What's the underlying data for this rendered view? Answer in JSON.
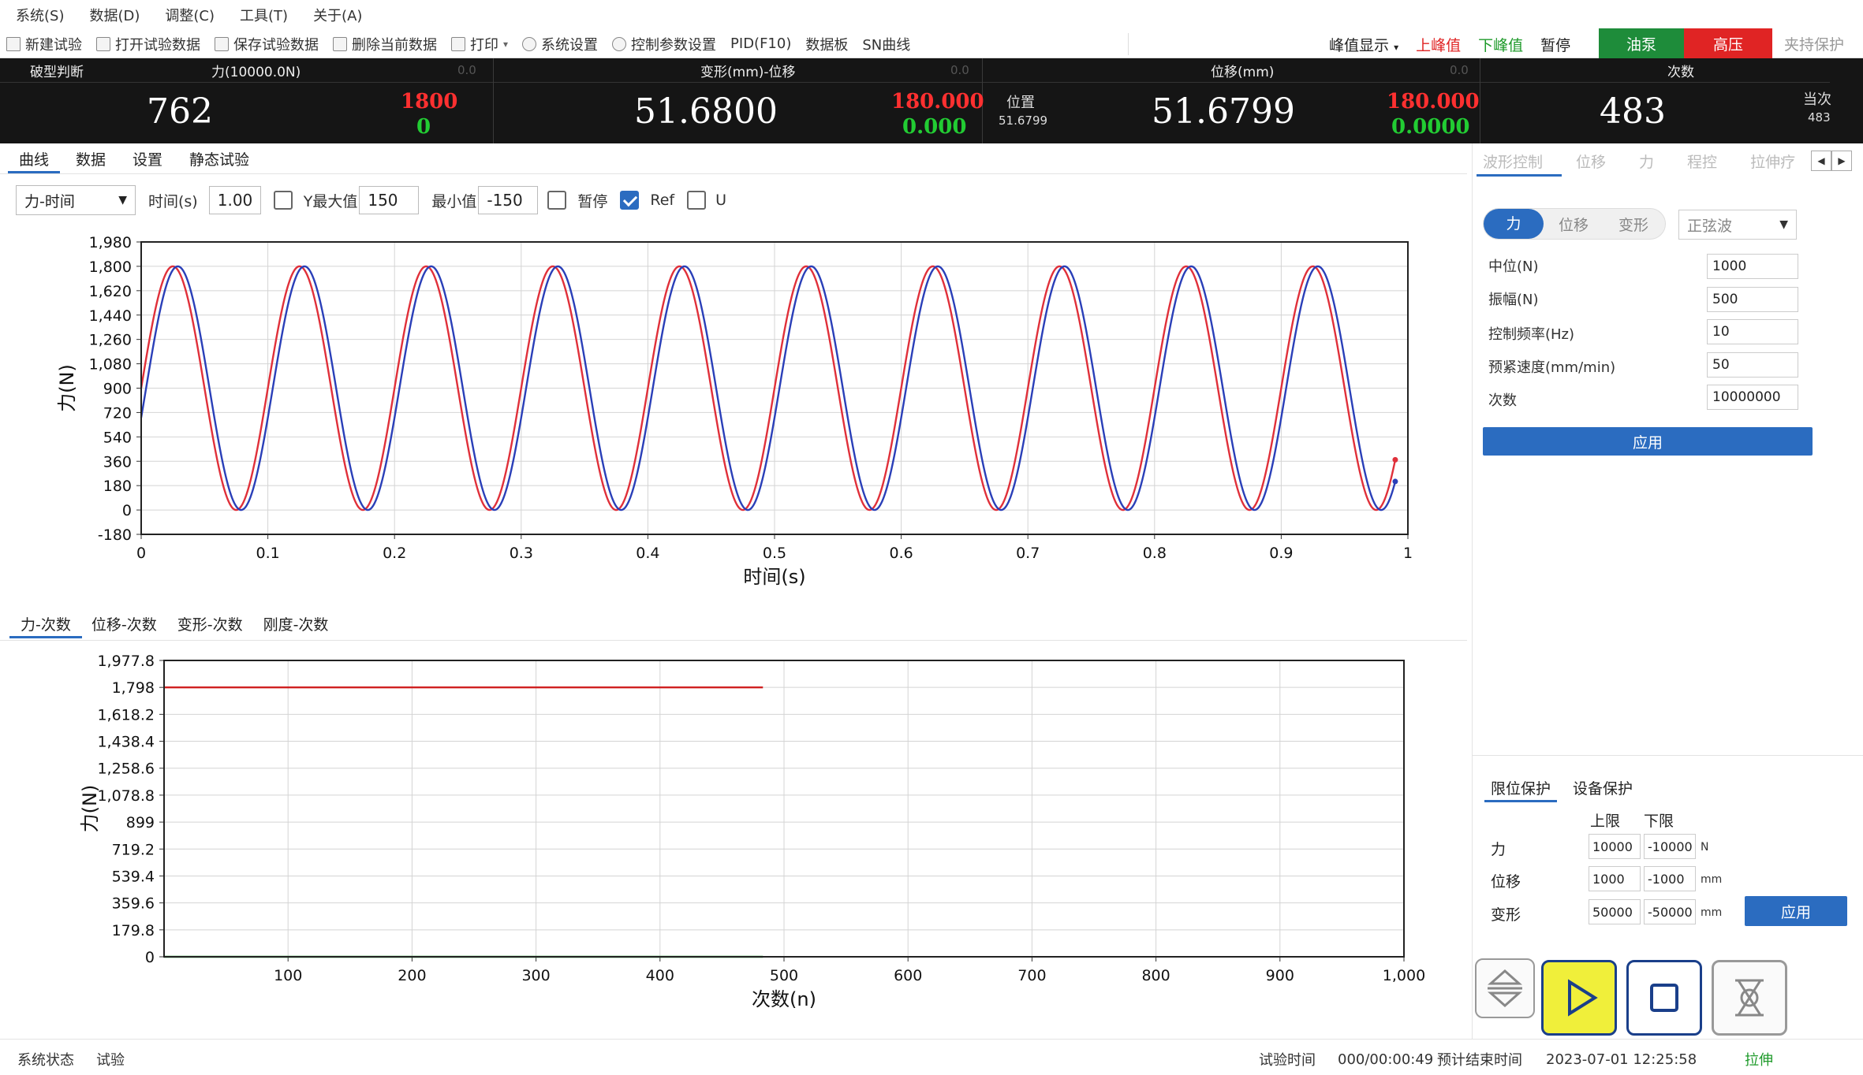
{
  "menu": [
    "系统(S)",
    "数据(D)",
    "调整(C)",
    "工具(T)",
    "关于(A)"
  ],
  "toolbar": {
    "items": [
      "新建试验",
      "打开试验数据",
      "保存试验数据",
      "删除当前数据",
      "打印",
      "系统设置",
      "控制参数设置",
      "PID(F10)",
      "数据板",
      "SN曲线"
    ],
    "peak_display": "峰值显示",
    "upper_peak": "上峰值",
    "lower_peak": "下峰值",
    "pause": "暂停",
    "oil_pump": "油泵",
    "high_pressure": "高压",
    "clamp_protect": "夹持保护"
  },
  "meter": {
    "breakage_label": "破型判断",
    "force_label": "力(10000.0N)",
    "force_faint": "0.0",
    "deform_label": "变形(mm)-位移",
    "deform_faint": "0.0",
    "disp_label": "位移(mm)",
    "disp_faint": "0.0",
    "count_label": "次数",
    "force_value": "762",
    "force_upper": "1800",
    "force_lower": "0",
    "deform_value": "51.6800",
    "deform_upper": "180.000",
    "deform_lower": "0.000",
    "pos_label": "位置",
    "pos_value": "51.6799",
    "disp_value": "51.6799",
    "disp_upper": "180.000",
    "disp_lower": "0.0000",
    "count_value": "483",
    "current_label": "当次",
    "current_value": "483"
  },
  "main_tabs": [
    "曲线",
    "数据",
    "设置",
    "静态试验"
  ],
  "chart1_controls": {
    "curve_select": "力-时间",
    "time_label": "时间(s)",
    "time_value": "1.00",
    "ymax_label": "Y最大值",
    "ymax_value": "150",
    "ymin_label": "最小值",
    "ymin_value": "-150",
    "pause_label": "暂停",
    "ref_label": "Ref",
    "u_label": "U"
  },
  "chart2_tabs": [
    "力-次数",
    "位移-次数",
    "变形-次数",
    "刚度-次数"
  ],
  "chart_data": [
    {
      "type": "line",
      "title": "",
      "xlabel": "时间(s)",
      "ylabel": "力(N)",
      "xlim": [
        0,
        1
      ],
      "ylim": [
        -180,
        1980
      ],
      "x_ticks": [
        "0",
        "0.1",
        "0.2",
        "0.3",
        "0.4",
        "0.5",
        "0.6",
        "0.7",
        "0.8",
        "0.9",
        "1"
      ],
      "y_ticks": [
        "-180",
        "0",
        "180",
        "360",
        "540",
        "720",
        "900",
        "1,080",
        "1,260",
        "1,440",
        "1,620",
        "1,800",
        "1,980"
      ],
      "grid": true,
      "series": [
        {
          "color": "#e0303a",
          "mean": 900,
          "amplitude": 900,
          "frequency_hz": 10,
          "phase_deg": 0,
          "x_end": 0.99
        },
        {
          "color": "#2a3fb8",
          "mean": 900,
          "amplitude": 900,
          "frequency_hz": 10,
          "phase_deg": -14,
          "x_end": 0.99
        }
      ]
    },
    {
      "type": "line",
      "title": "",
      "xlabel": "次数(n)",
      "ylabel": "力(N)",
      "xlim": [
        0,
        1000
      ],
      "ylim": [
        0,
        1977.8
      ],
      "x_ticks": [
        "100",
        "200",
        "300",
        "400",
        "500",
        "600",
        "700",
        "800",
        "900",
        "1,000"
      ],
      "y_ticks": [
        "0",
        "179.8",
        "359.6",
        "539.4",
        "719.2",
        "899",
        "1,078.8",
        "1,258.6",
        "1,438.4",
        "1,618.2",
        "1,798",
        "1,977.8"
      ],
      "grid": true,
      "series": [
        {
          "color": "#d02020",
          "x": [
            0,
            483
          ],
          "y": [
            1798,
            1798
          ]
        },
        {
          "color": "#1e9a2a",
          "x": [
            0,
            483
          ],
          "y": [
            0,
            0
          ]
        }
      ]
    }
  ],
  "right_panel": {
    "tabs": [
      "波形控制",
      "位移",
      "力",
      "程控",
      "拉伸疗"
    ],
    "mode_tabs": [
      "力",
      "位移",
      "变形"
    ],
    "wave_select": "正弦波",
    "params": [
      {
        "label": "中位(N)",
        "value": "1000"
      },
      {
        "label": "振幅(N)",
        "value": "500"
      },
      {
        "label": "控制频率(Hz)",
        "value": "10"
      },
      {
        "label": "预紧速度(mm/min)",
        "value": "50"
      },
      {
        "label": "次数",
        "value": "10000000"
      }
    ],
    "apply": "应用"
  },
  "limit_panel": {
    "tabs": [
      "限位保护",
      "设备保护"
    ],
    "upper_label": "上限",
    "lower_label": "下限",
    "rows": [
      {
        "label": "力",
        "upper": "10000",
        "lower": "-10000",
        "unit": "N"
      },
      {
        "label": "位移",
        "upper": "1000",
        "lower": "-1000",
        "unit": "mm"
      },
      {
        "label": "变形",
        "upper": "50000",
        "lower": "-50000",
        "unit": "mm"
      }
    ],
    "apply": "应用"
  },
  "status": {
    "system_label": "系统状态",
    "system_value": "试验",
    "test_time_label": "试验时间",
    "test_time_value": "000/00:00:49",
    "eta_label": "预计结束时间",
    "eta_value": "2023-07-01 12:25:58",
    "mode_value": "拉伸"
  },
  "colors": {
    "accent": "#2b6cc0",
    "pump": "#1e8c3a",
    "high_pressure": "#e02424",
    "upper_peak": "#e02424",
    "lower_peak": "#1e9a2a",
    "play_button": "#f0ef3a"
  }
}
